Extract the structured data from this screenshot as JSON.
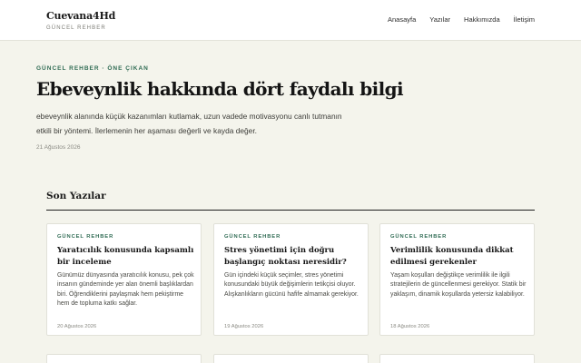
{
  "header": {
    "brand": "Cuevana4Hd",
    "tagline": "GÜNCEL REHBER",
    "nav": [
      "Anasayfa",
      "Yazılar",
      "Hakkımızda",
      "İletişim"
    ]
  },
  "hero": {
    "kicker": "GÜNCEL REHBER · ÖNE ÇIKAN",
    "title": "Ebeveynlik hakkında dört faydalı bilgi",
    "excerpt": "ebeveynlik alanında küçük kazanımları kutlamak, uzun vadede motivasyonu canlı tutmanın etkili bir yöntemi. İlerlemenin her aşaması değerli ve kayda değer.",
    "date": "21 Ağustos 2026"
  },
  "section": {
    "title": "Son Yazılar"
  },
  "cards": [
    {
      "kicker": "GÜNCEL REHBER",
      "title": "Yaratıcılık konusunda kapsamlı bir inceleme",
      "excerpt": "Günümüz dünyasında yaratıcılık konusu, pek çok insanın gündeminde yer alan önemli başlıklardan biri. Öğrendiklerini paylaşmak hem pekiştirme hem de topluma katkı sağlar.",
      "date": "20 Ağustos 2026"
    },
    {
      "kicker": "GÜNCEL REHBER",
      "title": "Stres yönetimi için doğru başlangıç noktası neresidir?",
      "excerpt": "Gün içindeki küçük seçimler, stres yönetimi konusundaki büyük değişimlerin tetikçisi oluyor. Alışkanlıkların gücünü hafife almamak gerekiyor.",
      "date": "19 Ağustos 2026"
    },
    {
      "kicker": "GÜNCEL REHBER",
      "title": "Verimlilik konusunda dikkat edilmesi gerekenler",
      "excerpt": "Yaşam koşulları değiştikçe verimlilik ile ilgili stratejilerin de güncellenmesi gerekiyor. Statik bir yaklaşım, dinamik koşullarda yetersiz kalabiliyor.",
      "date": "18 Ağustos 2026"
    }
  ]
}
